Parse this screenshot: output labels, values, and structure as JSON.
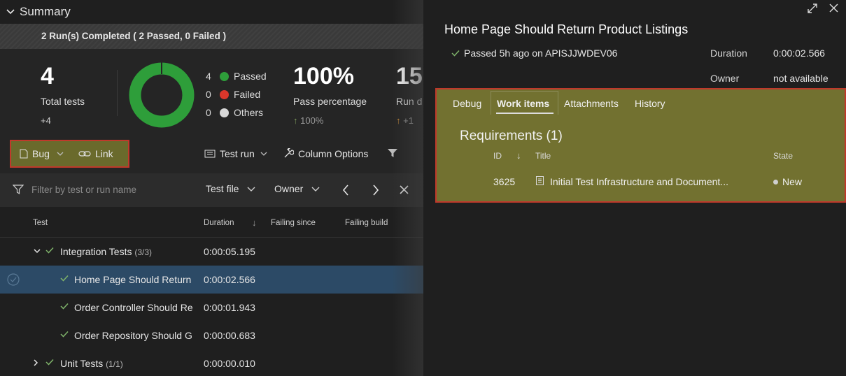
{
  "summary": {
    "title": "Summary",
    "completed": "2 Run(s) Completed ( 2 Passed, 0 Failed )"
  },
  "stats": {
    "total_tests": "4",
    "total_label": "Total tests",
    "total_delta": "+4",
    "legend": [
      {
        "count": "4",
        "label": "Passed",
        "color": "#2e9e3a"
      },
      {
        "count": "0",
        "label": "Failed",
        "color": "#d9372b"
      },
      {
        "count": "0",
        "label": "Others",
        "color": "#d8d8d8"
      }
    ],
    "pass_pct": "100%",
    "pass_label": "Pass percentage",
    "pass_delta": "100%",
    "run_duration": "15",
    "run_label": "Run d",
    "run_delta": "+1"
  },
  "toolbar": {
    "bug": "Bug",
    "link": "Link",
    "test_run": "Test run",
    "column_options": "Column Options"
  },
  "filter": {
    "placeholder": "Filter by test or run name",
    "test_file": "Test file",
    "owner": "Owner"
  },
  "table": {
    "headers": {
      "test": "Test",
      "duration": "Duration",
      "failing_since": "Failing since",
      "failing_build": "Failing build"
    },
    "rows": [
      {
        "name": "Integration Tests",
        "count": "(3/3)",
        "duration": "0:00:05.195"
      },
      {
        "name": "Home Page Should Return",
        "duration": "0:00:02.566"
      },
      {
        "name": "Order Controller Should Re",
        "duration": "0:00:01.943"
      },
      {
        "name": "Order Repository Should G",
        "duration": "0:00:00.683"
      },
      {
        "name": "Unit Tests",
        "count": "(1/1)",
        "duration": "0:00:00.010"
      }
    ]
  },
  "detail": {
    "title": "Home Page Should Return Product Listings",
    "passed": "Passed 5h ago on APISJJWDEV06",
    "duration_label": "Duration",
    "duration_value": "0:00:02.566",
    "owner_label": "Owner",
    "owner_value": "not available",
    "tabs": [
      "Debug",
      "Work items",
      "Attachments",
      "History"
    ],
    "requirements_title": "Requirements (1)",
    "columns": {
      "id": "ID",
      "title": "Title",
      "state": "State"
    },
    "requirement": {
      "id": "3625",
      "title": "Initial Test Infrastructure and Document...",
      "state": "New"
    }
  },
  "colors": {
    "accent_green": "#2e9e3a",
    "highlight_box": "#c0392b",
    "selected_row": "#2c4a66"
  }
}
